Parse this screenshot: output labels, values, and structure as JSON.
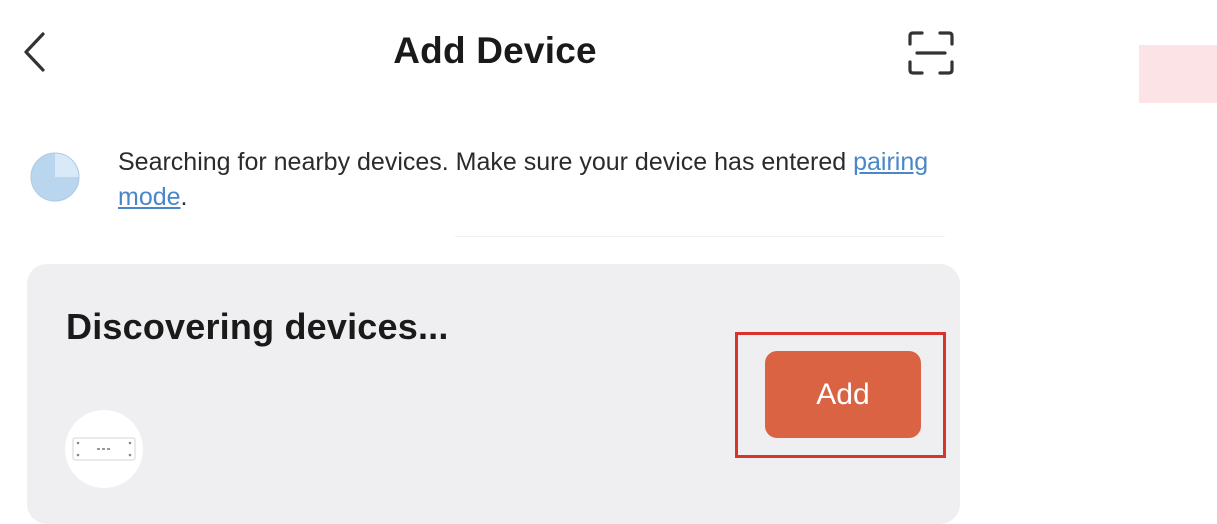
{
  "header": {
    "title": "Add Device",
    "back_icon": "chevron-left-icon",
    "scan_icon": "scan-frame-icon"
  },
  "notice": {
    "icon": "loading-spinner-icon",
    "text_before": "Searching for nearby devices. Make sure your device has entered ",
    "link_label": "pairing mode",
    "text_after": "."
  },
  "discovery": {
    "title": "Discovering devices...",
    "device_icon": "device-thumbnail-icon",
    "add_label": "Add"
  },
  "colors": {
    "accent_button": "#da6344",
    "highlight_border": "#d9342b",
    "link": "#4a86c8",
    "card_background": "#efeff1",
    "spinner": "#b9d6ee"
  }
}
